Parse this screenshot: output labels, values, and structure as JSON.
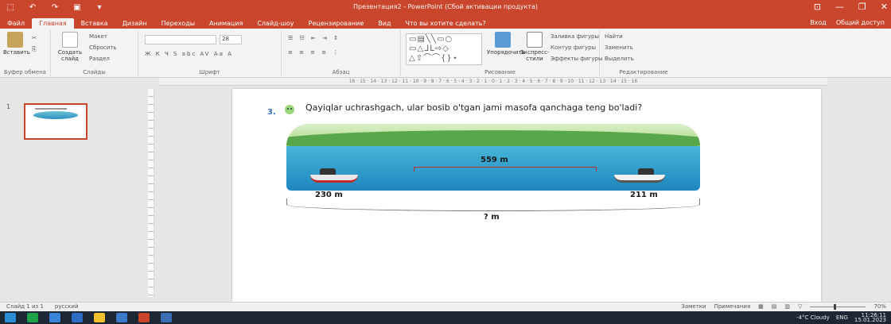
{
  "window": {
    "title": "Презентация2 - PowerPoint (Сбой активации продукта)",
    "controls": [
      "⊡",
      "—",
      "❐",
      "✕"
    ]
  },
  "quick_access": [
    "⬚",
    "↶",
    "↷",
    "▣",
    "▾"
  ],
  "tabs": [
    "Файл",
    "Главная",
    "Вставка",
    "Дизайн",
    "Переходы",
    "Анимация",
    "Слайд-шоу",
    "Рецензирование",
    "Вид",
    "Что вы хотите сделать?"
  ],
  "tabs_right": {
    "sign_in": "Вход",
    "share": "Общий доступ"
  },
  "ribbon": {
    "clipboard": {
      "paste": "Вставить",
      "group": "Буфер обмена"
    },
    "slides": {
      "new_slide": "Создать слайд",
      "layout": "Макет",
      "reset": "Сбросить",
      "section": "Раздел",
      "group": "Слайды"
    },
    "font": {
      "group": "Шрифт",
      "size": "28",
      "style_row": "Ж К Ч S abc AV Aa A"
    },
    "paragraph": {
      "group": "Абзац"
    },
    "drawing": {
      "arrange": "Упорядочить",
      "quick_styles": "Экспресс-стили",
      "fill": "Заливка фигуры",
      "outline": "Контур фигуры",
      "effects": "Эффекты фигуры",
      "group": "Рисование",
      "shapes": "▭▤╲╲▭○ ▭△ᒧᒪ⇨◇ △⇧⌒⌒{}⋆"
    },
    "editing": {
      "find": "Найти",
      "replace": "Заменить",
      "select": "Выделить",
      "group": "Редактирование"
    }
  },
  "ruler_text": "16 · 15 · 14 · 13 · 12 · 11 · 10 · 9 · 8 · 7 · 6 · 5 · 4 · 3 · 2 · 1 · 0 · 1 · 2 · 3 · 4 · 5 · 6 · 7 · 8 · 9 · 10 · 11 · 12 · 13 · 14 · 15 · 16",
  "slide_pane": {
    "number": "1"
  },
  "slide": {
    "question_number": "3.",
    "question_text": "Qayiqlar uchrashgach, ular bosib o'tgan jami masofa qanchaga teng bo'ladi?",
    "middle_distance": "559 m",
    "left_distance": "230 m",
    "right_distance": "211 m",
    "total_distance": "? m"
  },
  "status": {
    "slide_info": "Слайд 1 из 1",
    "language": "русский",
    "notes": "Заметки",
    "comments": "Примечания",
    "zoom": "70%"
  },
  "taskbar": {
    "weather": "-4°C Cloudy",
    "lang": "ENG",
    "time": "11:26:11",
    "date": "15.01.2023",
    "icon_colors": [
      "#2b8fd6",
      "#1ea34a",
      "#3b83d8",
      "#2d6dc6",
      "#f2c12e",
      "#3b79c9",
      "#c9452b",
      "#3a6fb5"
    ]
  }
}
